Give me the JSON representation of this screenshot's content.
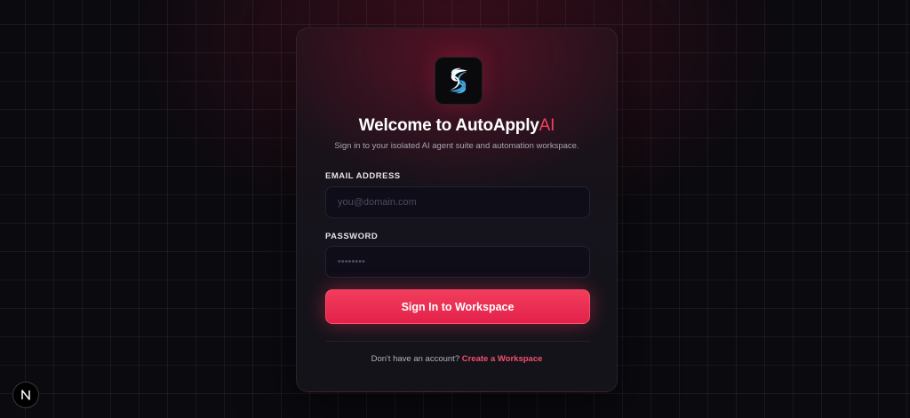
{
  "login": {
    "logo_icon": "swirl-logo-icon",
    "title_main": "Welcome to AutoApply",
    "title_accent": "AI",
    "subtitle": "Sign in to your isolated AI agent suite and automation workspace.",
    "email_label": "EMAIL ADDRESS",
    "email_placeholder": "you@domain.com",
    "email_value": "",
    "password_label": "PASSWORD",
    "password_placeholder": "••••••••",
    "password_value": "",
    "submit_label": "Sign In to Workspace",
    "footer_text": "Don't have an account?",
    "footer_link": "Create a Workspace"
  },
  "dev_badge": {
    "icon": "nextjs-icon",
    "letter": "N"
  },
  "colors": {
    "accent": "#f0405e",
    "background": "#0b0a0f",
    "card": "#15131b",
    "input_bg": "#0e0d18"
  }
}
